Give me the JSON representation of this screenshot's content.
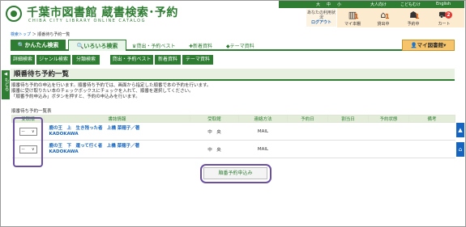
{
  "header": {
    "site_title": "千葉市図書館 蔵書検索･予約",
    "site_subtitle": "CHIBA CITY LIBRARY ONLINE CATALOG",
    "font_size_labels": [
      "大",
      "中",
      "小"
    ],
    "links": [
      "大人向け",
      "こどもむけ",
      "English"
    ],
    "user_status_label": "あなたの利用状況",
    "logout_label": "ログアウト",
    "icons": [
      {
        "name": "my-bookshelf-icon",
        "label": "マイ本棚",
        "badge": "1"
      },
      {
        "name": "loans-icon",
        "label": "貸出中",
        "badge": "1"
      },
      {
        "name": "reservations-icon",
        "label": "予約中",
        "badge": "1"
      },
      {
        "name": "cart-icon",
        "label": "カート",
        "badge": "2"
      }
    ]
  },
  "breadcrumb": {
    "home": "検索トップ",
    "separator": " ＞ ",
    "current": "順番待ち予約一覧"
  },
  "main_nav": {
    "simple_search": "かんたん検索",
    "various_search": "いろいろ検索",
    "links": [
      {
        "icon": "ranking-icon",
        "label": "貸出・予約ベスト"
      },
      {
        "icon": "new-items-icon",
        "label": "新着資料"
      },
      {
        "icon": "theme-icon",
        "label": "テーマ資料"
      }
    ],
    "my_library": "マイ図書館"
  },
  "sub_nav": [
    "詳細検索",
    "ジャンル検索",
    "分類検索",
    "貸出・予約ベスト",
    "新着資料",
    "テーマ資料"
  ],
  "side": {
    "left_tab": "もどる"
  },
  "page": {
    "title": "順番待ち予約一覧",
    "description": [
      "順番待ち予約の申込を行います。順番待ち予約では、画面から指定した順番で本の予約を行います。",
      "順番に受け取りたい本のチェックボックスにチェックを入れて、順番を選択してください。",
      "「順番予約申込み」ボタンを押すと、予約の申込みを行います。"
    ],
    "list_caption": "順番待ち予約一覧表"
  },
  "table": {
    "headers": [
      "受取順",
      "書誌情報",
      "受取館",
      "連絡方法",
      "予約日",
      "割当日",
      "予約状態",
      "備考"
    ],
    "rows": [
      {
        "order": "--",
        "title": "鹿の王　上　生き残った者　上橋 菜穂子／著",
        "publisher": "KADOKAWA",
        "branch": "中　央",
        "contact": "MAIL",
        "reserve_date": "",
        "assign_date": "",
        "status": "",
        "note": ""
      },
      {
        "order": "--",
        "title": "鹿の王　下　還って行く者　上橋 菜穂子／著",
        "publisher": "KADOKAWA",
        "branch": "中　央",
        "contact": "MAIL",
        "reserve_date": "",
        "assign_date": "",
        "status": "",
        "note": ""
      }
    ]
  },
  "submit_label": "順番予約申込み",
  "colors": {
    "brand_green": "#2e7d32",
    "link_blue": "#1565c0",
    "highlight_purple": "#6b4fa0",
    "my_library_orange": "#f6c46b"
  }
}
